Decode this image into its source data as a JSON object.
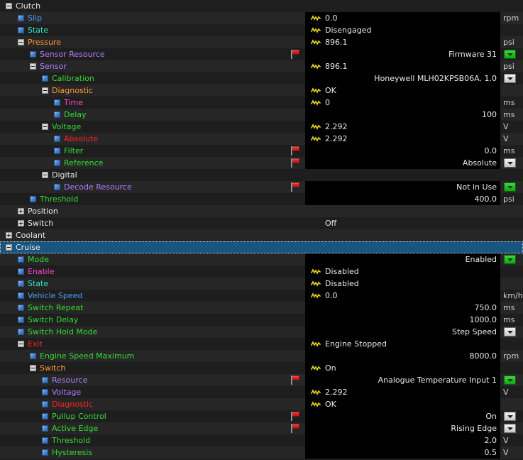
{
  "meta": {
    "colors": {
      "background_alt_a": "#1e1e1e",
      "background_alt_b": "#262626",
      "selection": "#18557f",
      "editfield": "#000000",
      "text": "#e8e8e8",
      "blue": "#4a9ff5",
      "cyan": "#2ee8c0",
      "orange": "#ff9933",
      "purple": "#b07fff",
      "green": "#33dd33",
      "magenta": "#ff44cc",
      "red": "#ff2222",
      "white": "#e8e8e8",
      "flag": "#e02020",
      "wave": "#e8d820",
      "combo_modified": "#22c022"
    },
    "icons": {
      "expander_collapsed": "plus-box-icon",
      "expander_expanded": "minus-box-icon",
      "leaf": "blue-square-icon",
      "flag": "red-flag-icon",
      "wave": "yellow-waveform-icon",
      "combo": "chevron-down-icon"
    }
  },
  "rows": [
    {
      "depth": 0,
      "node": "expanded",
      "label": "Clutch",
      "color": "white",
      "value": "",
      "wave": false,
      "unit": "",
      "align": "left",
      "combo": "",
      "flag": false,
      "edit": false,
      "selected": false
    },
    {
      "depth": 1,
      "node": "leaf",
      "label": "Slip",
      "color": "blue",
      "value": "0.0",
      "wave": true,
      "unit": "rpm",
      "align": "left",
      "combo": "",
      "flag": false,
      "edit": true,
      "selected": false
    },
    {
      "depth": 1,
      "node": "leaf",
      "label": "State",
      "color": "cyan",
      "value": "Disengaged",
      "wave": true,
      "unit": "",
      "align": "left",
      "combo": "",
      "flag": false,
      "edit": true,
      "selected": false
    },
    {
      "depth": 1,
      "node": "expanded",
      "label": "Pressure",
      "color": "orange",
      "value": "896.1",
      "wave": true,
      "unit": "psi",
      "align": "left",
      "combo": "",
      "flag": false,
      "edit": true,
      "selected": false
    },
    {
      "depth": 2,
      "node": "leaf",
      "label": "Sensor Resource",
      "color": "purple",
      "value": "Firmware 31",
      "wave": false,
      "unit": "",
      "align": "right",
      "combo": "green",
      "flag": true,
      "edit": true,
      "selected": false
    },
    {
      "depth": 2,
      "node": "expanded",
      "label": "Sensor",
      "color": "purple",
      "value": "896.1",
      "wave": true,
      "unit": "psi",
      "align": "left",
      "combo": "",
      "flag": false,
      "edit": true,
      "selected": false
    },
    {
      "depth": 3,
      "node": "leaf",
      "label": "Calibration",
      "color": "green",
      "value": "Honeywell MLH02KPSB06A. 1.0",
      "wave": false,
      "unit": "",
      "align": "right",
      "combo": "gray",
      "flag": false,
      "edit": true,
      "selected": false
    },
    {
      "depth": 3,
      "node": "expanded",
      "label": "Diagnostic",
      "color": "orange",
      "value": "OK",
      "wave": true,
      "unit": "",
      "align": "left",
      "combo": "",
      "flag": false,
      "edit": true,
      "selected": false
    },
    {
      "depth": 4,
      "node": "leaf",
      "label": "Time",
      "color": "magenta",
      "value": "0",
      "wave": true,
      "unit": "ms",
      "align": "left",
      "combo": "",
      "flag": false,
      "edit": true,
      "selected": false
    },
    {
      "depth": 4,
      "node": "leaf",
      "label": "Delay",
      "color": "green",
      "value": "100",
      "wave": false,
      "unit": "ms",
      "align": "right",
      "combo": "",
      "flag": false,
      "edit": true,
      "selected": false
    },
    {
      "depth": 3,
      "node": "expanded",
      "label": "Voltage",
      "color": "green",
      "value": "2.292",
      "wave": true,
      "unit": "V",
      "align": "left",
      "combo": "",
      "flag": false,
      "edit": true,
      "selected": false
    },
    {
      "depth": 4,
      "node": "leaf",
      "label": "Absolute",
      "color": "red",
      "value": "2.292",
      "wave": true,
      "unit": "V",
      "align": "left",
      "combo": "",
      "flag": false,
      "edit": true,
      "selected": false
    },
    {
      "depth": 4,
      "node": "leaf",
      "label": "Filter",
      "color": "green",
      "value": "0.0",
      "wave": false,
      "unit": "ms",
      "align": "right",
      "combo": "",
      "flag": true,
      "edit": true,
      "selected": false
    },
    {
      "depth": 4,
      "node": "leaf",
      "label": "Reference",
      "color": "green",
      "value": "Absolute",
      "wave": false,
      "unit": "",
      "align": "right",
      "combo": "gray",
      "flag": true,
      "edit": true,
      "selected": false
    },
    {
      "depth": 3,
      "node": "expanded",
      "label": "Digital",
      "color": "white",
      "value": "",
      "wave": false,
      "unit": "",
      "align": "left",
      "combo": "",
      "flag": false,
      "edit": false,
      "selected": false
    },
    {
      "depth": 4,
      "node": "leaf",
      "label": "Decode Resource",
      "color": "purple",
      "value": "Not in Use",
      "wave": false,
      "unit": "",
      "align": "right",
      "combo": "green",
      "flag": true,
      "edit": true,
      "selected": false
    },
    {
      "depth": 2,
      "node": "leaf",
      "label": "Threshold",
      "color": "green",
      "value": "400.0",
      "wave": false,
      "unit": "psi",
      "align": "right",
      "combo": "",
      "flag": false,
      "edit": true,
      "selected": false
    },
    {
      "depth": 1,
      "node": "collapsed",
      "label": "Position",
      "color": "white",
      "value": "",
      "wave": false,
      "unit": "",
      "align": "left",
      "combo": "",
      "flag": false,
      "edit": false,
      "selected": false
    },
    {
      "depth": 1,
      "node": "collapsed",
      "label": "Switch",
      "color": "white",
      "value": "Off",
      "wave": false,
      "unit": "",
      "align": "left",
      "combo": "",
      "flag": false,
      "edit": false,
      "selected": false
    },
    {
      "depth": 0,
      "node": "collapsed",
      "label": "Coolant",
      "color": "white",
      "value": "",
      "wave": false,
      "unit": "",
      "align": "left",
      "combo": "",
      "flag": false,
      "edit": false,
      "selected": false
    },
    {
      "depth": 0,
      "node": "expanded",
      "label": "Cruise",
      "color": "white",
      "value": "",
      "wave": false,
      "unit": "",
      "align": "left",
      "combo": "",
      "flag": false,
      "edit": false,
      "selected": true
    },
    {
      "depth": 1,
      "node": "leaf",
      "label": "Mode",
      "color": "green",
      "value": "Enabled",
      "wave": false,
      "unit": "",
      "align": "right",
      "combo": "green",
      "flag": false,
      "edit": true,
      "selected": false
    },
    {
      "depth": 1,
      "node": "leaf",
      "label": "Enable",
      "color": "magenta",
      "value": "Disabled",
      "wave": true,
      "unit": "",
      "align": "left",
      "combo": "",
      "flag": false,
      "edit": true,
      "selected": false
    },
    {
      "depth": 1,
      "node": "leaf",
      "label": "State",
      "color": "cyan",
      "value": "Disabled",
      "wave": true,
      "unit": "",
      "align": "left",
      "combo": "",
      "flag": false,
      "edit": true,
      "selected": false
    },
    {
      "depth": 1,
      "node": "leaf",
      "label": "Vehicle Speed",
      "color": "blue",
      "value": "0.0",
      "wave": true,
      "unit": "km/h",
      "align": "left",
      "combo": "",
      "flag": false,
      "edit": true,
      "selected": false
    },
    {
      "depth": 1,
      "node": "leaf",
      "label": "Switch Repeat",
      "color": "green",
      "value": "750.0",
      "wave": false,
      "unit": "ms",
      "align": "right",
      "combo": "",
      "flag": false,
      "edit": true,
      "selected": false
    },
    {
      "depth": 1,
      "node": "leaf",
      "label": "Switch Delay",
      "color": "green",
      "value": "1000.0",
      "wave": false,
      "unit": "ms",
      "align": "right",
      "combo": "",
      "flag": false,
      "edit": true,
      "selected": false
    },
    {
      "depth": 1,
      "node": "leaf",
      "label": "Switch Hold Mode",
      "color": "green",
      "value": "Step Speed",
      "wave": false,
      "unit": "",
      "align": "right",
      "combo": "gray",
      "flag": false,
      "edit": true,
      "selected": false
    },
    {
      "depth": 1,
      "node": "expanded",
      "label": "Exit",
      "color": "red",
      "value": "Engine Stopped",
      "wave": true,
      "unit": "",
      "align": "left",
      "combo": "",
      "flag": false,
      "edit": true,
      "selected": false
    },
    {
      "depth": 2,
      "node": "leaf",
      "label": "Engine Speed Maximum",
      "color": "green",
      "value": "8000.0",
      "wave": false,
      "unit": "rpm",
      "align": "right",
      "combo": "",
      "flag": false,
      "edit": true,
      "selected": false
    },
    {
      "depth": 2,
      "node": "expanded",
      "label": "Switch",
      "color": "orange",
      "value": "On",
      "wave": true,
      "unit": "",
      "align": "left",
      "combo": "",
      "flag": false,
      "edit": true,
      "selected": false
    },
    {
      "depth": 3,
      "node": "leaf",
      "label": "Resource",
      "color": "purple",
      "value": "Analogue Temperature Input 1",
      "wave": false,
      "unit": "",
      "align": "right",
      "combo": "green",
      "flag": true,
      "edit": true,
      "selected": false
    },
    {
      "depth": 3,
      "node": "leaf",
      "label": "Voltage",
      "color": "purple",
      "value": "2.292",
      "wave": true,
      "unit": "V",
      "align": "left",
      "combo": "",
      "flag": false,
      "edit": true,
      "selected": false
    },
    {
      "depth": 3,
      "node": "leaf",
      "label": "Diagnostic",
      "color": "red",
      "value": "OK",
      "wave": true,
      "unit": "",
      "align": "left",
      "combo": "",
      "flag": false,
      "edit": true,
      "selected": false
    },
    {
      "depth": 3,
      "node": "leaf",
      "label": "Pullup Control",
      "color": "green",
      "value": "On",
      "wave": false,
      "unit": "",
      "align": "right",
      "combo": "gray",
      "flag": true,
      "edit": true,
      "selected": false
    },
    {
      "depth": 3,
      "node": "leaf",
      "label": "Active Edge",
      "color": "green",
      "value": "Rising Edge",
      "wave": false,
      "unit": "",
      "align": "right",
      "combo": "gray",
      "flag": true,
      "edit": true,
      "selected": false
    },
    {
      "depth": 3,
      "node": "leaf",
      "label": "Threshold",
      "color": "green",
      "value": "2.0",
      "wave": false,
      "unit": "V",
      "align": "right",
      "combo": "",
      "flag": false,
      "edit": true,
      "selected": false
    },
    {
      "depth": 3,
      "node": "leaf",
      "label": "Hysteresis",
      "color": "green",
      "value": "0.5",
      "wave": false,
      "unit": "V",
      "align": "right",
      "combo": "",
      "flag": false,
      "edit": true,
      "selected": false
    }
  ]
}
